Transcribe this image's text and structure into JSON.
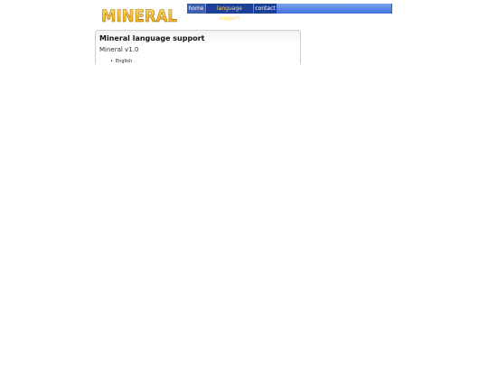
{
  "logo": {
    "text": "MINERAL"
  },
  "nav": {
    "items": [
      {
        "label": "home"
      },
      {
        "label": "language support"
      },
      {
        "label": "contact"
      }
    ],
    "active": "language support"
  },
  "panel": {
    "title": "Mineral language support",
    "subtitle": "Mineral v1.0",
    "languages": [
      "English"
    ]
  },
  "colors": {
    "nav_gradient_top": "#7ea3ef",
    "nav_gradient_bottom": "#3f6fdc",
    "nav_active_text": "#ffd95a",
    "logo_fill": "#f2b824",
    "logo_stroke": "#a76b00"
  }
}
